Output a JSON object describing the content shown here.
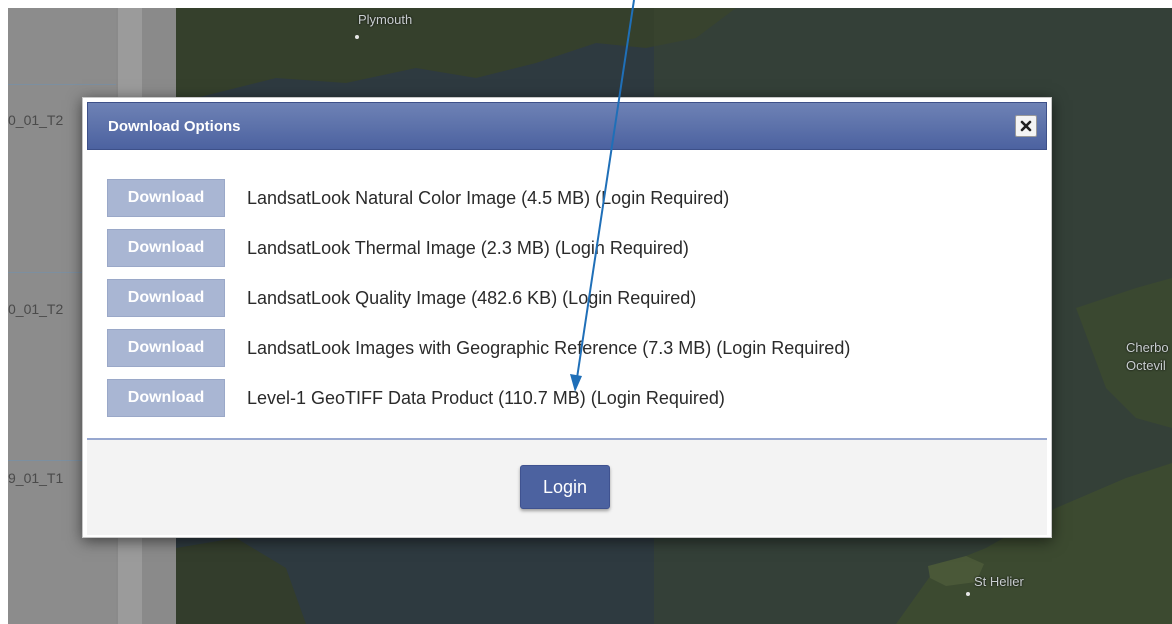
{
  "background": {
    "result_rows": [
      {
        "label": "0_01_T2"
      },
      {
        "label": "0_01_T2"
      },
      {
        "label": "9_01_T1"
      }
    ],
    "map_labels": {
      "plymouth": "Plymouth",
      "st_helier": "St Helier",
      "cherbourg": "Cherbo",
      "octeville": "Octevil"
    }
  },
  "modal": {
    "title": "Download Options",
    "close_icon": "close-x-icon",
    "options": [
      {
        "button": "Download",
        "text": "LandsatLook Natural Color Image (4.5 MB) (Login Required)"
      },
      {
        "button": "Download",
        "text": "LandsatLook Thermal Image (2.3 MB) (Login Required)"
      },
      {
        "button": "Download",
        "text": "LandsatLook Quality Image (482.6 KB) (Login Required)"
      },
      {
        "button": "Download",
        "text": "LandsatLook Images with Geographic Reference (7.3 MB) (Login Required)"
      },
      {
        "button": "Download",
        "text": "Level-1 GeoTIFF Data Product (110.7 MB) (Login Required)"
      }
    ],
    "footer": {
      "login_label": "Login"
    }
  },
  "colors": {
    "header_blue": "#4c62a0",
    "download_button": "#a9b6d3",
    "annotation_arrow": "#1f6fb8"
  }
}
